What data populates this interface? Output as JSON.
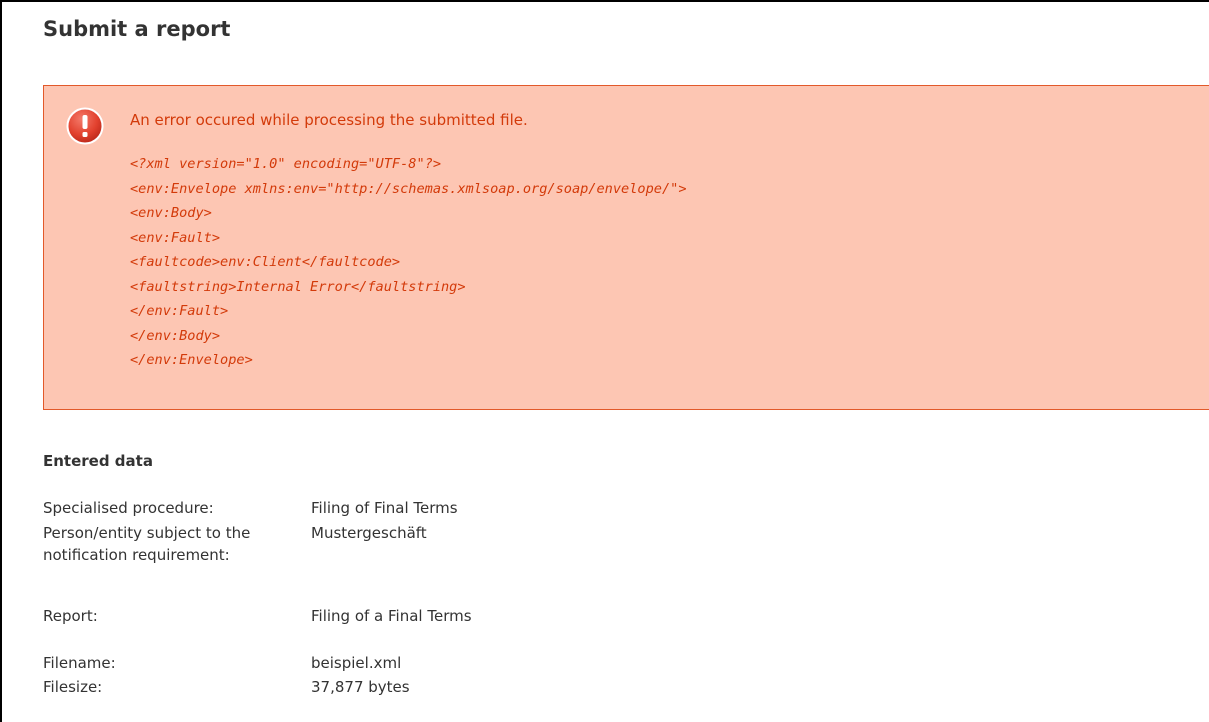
{
  "page": {
    "title": "Submit a report"
  },
  "error": {
    "icon": "exclamation-icon",
    "message": "An error occured while processing the submitted file.",
    "code_lines": [
      "<?xml version=\"1.0\" encoding=\"UTF-8\"?>",
      "<env:Envelope xmlns:env=\"http://schemas.xmlsoap.org/soap/envelope/\">",
      "<env:Body>",
      "<env:Fault>",
      "<faultcode>env:Client</faultcode>",
      "<faultstring>Internal Error</faultstring>",
      "</env:Fault>",
      "</env:Body>",
      "</env:Envelope>"
    ],
    "colors": {
      "background": "#fdc6b3",
      "border": "#e2592a",
      "text": "#d33a0a"
    }
  },
  "entered_data": {
    "heading": "Entered data",
    "fields": [
      {
        "label": "Specialised procedure:",
        "value": "Filing of Final Terms"
      },
      {
        "label": "Person/entity subject to the notification requirement:",
        "value": "Mustergeschäft"
      },
      {
        "label": "Report:",
        "value": "Filing of a Final Terms"
      },
      {
        "label": "Filename:",
        "value": "beispiel.xml"
      },
      {
        "label": "Filesize:",
        "value": "37,877 bytes"
      }
    ]
  }
}
